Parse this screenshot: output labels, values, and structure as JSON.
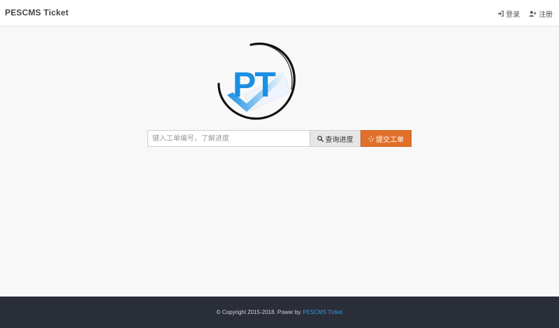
{
  "header": {
    "brand": "PESCMS Ticket",
    "login_label": "登录",
    "register_label": "注册"
  },
  "logo": {
    "text": "PT"
  },
  "search": {
    "placeholder": "键入工单编号，了解进度",
    "query_button": "查询进度",
    "submit_button": "提交工单"
  },
  "footer": {
    "copyright_text": "© Copyright 2015-2018. Power by",
    "link_text": "PESCMS Ticket"
  },
  "colors": {
    "accent_orange": "#e0702a",
    "link_blue": "#2b9be8",
    "footer_bg": "#2a2e38",
    "logo_blue": "#1a8fe3"
  }
}
